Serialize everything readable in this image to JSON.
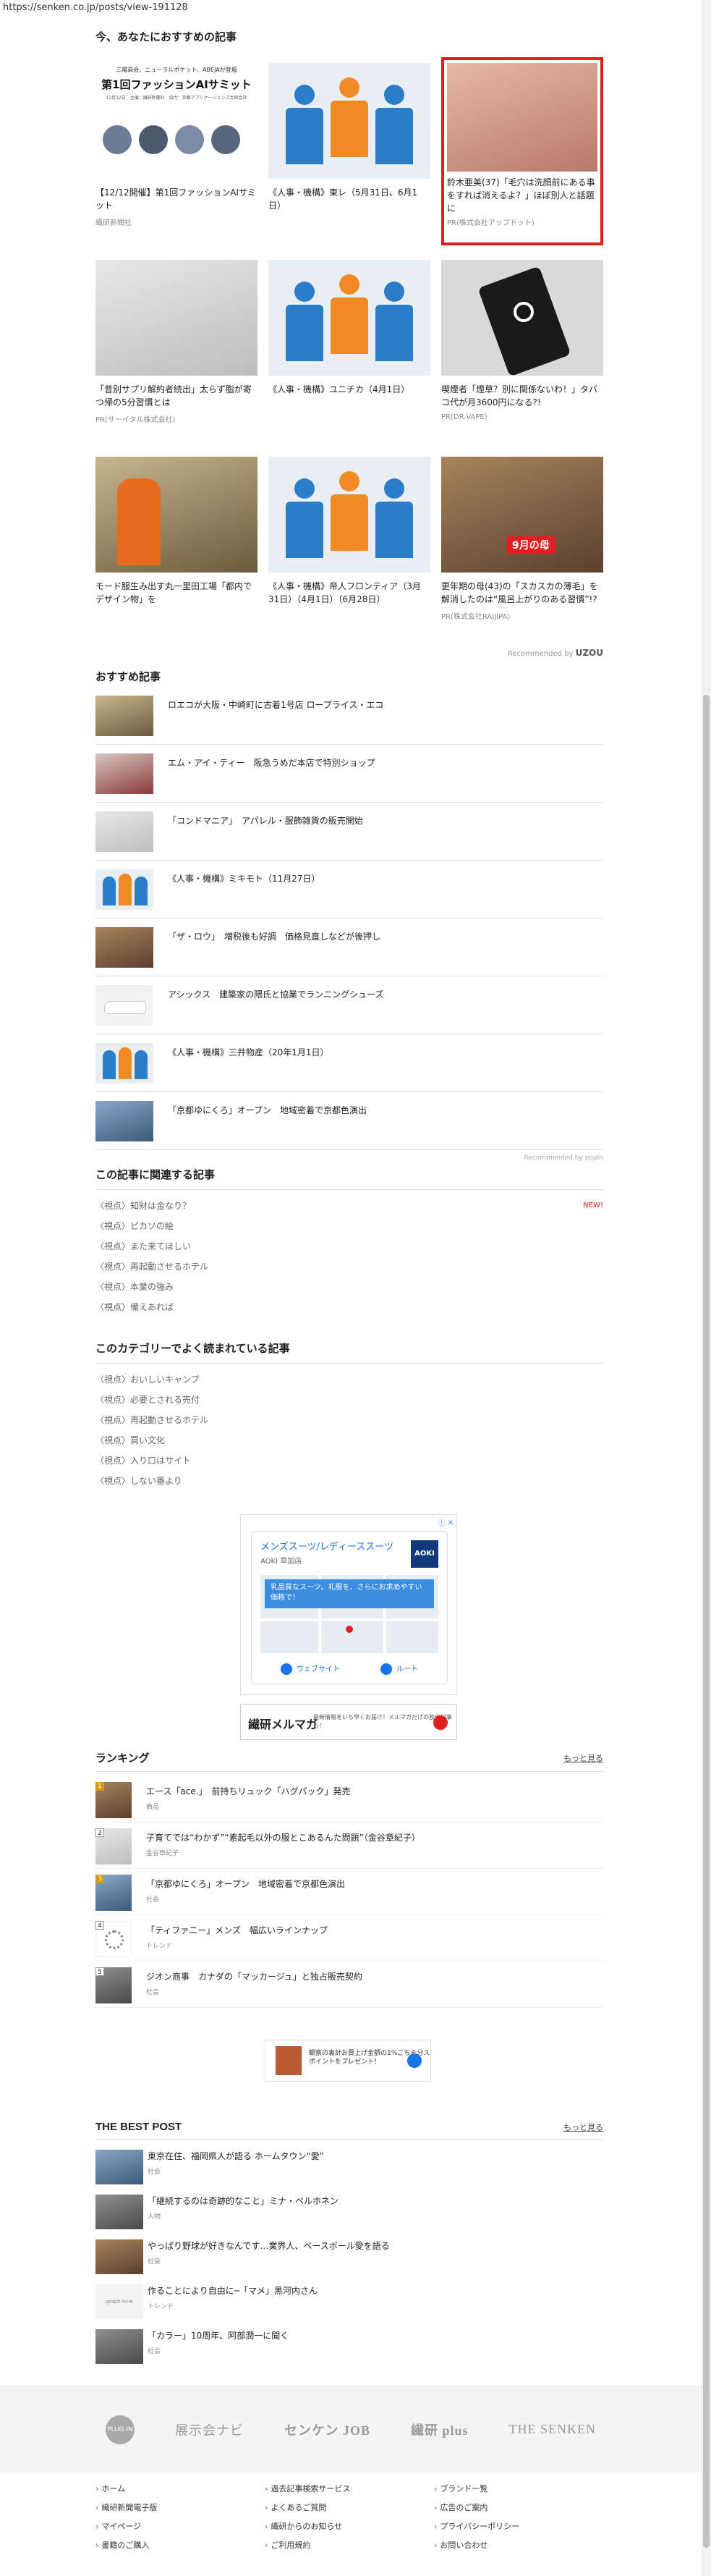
{
  "browser": {
    "url": "https://senken.co.jp/posts/view-191128"
  },
  "recommend": {
    "title": "今、あなたにおすすめの記事",
    "cards": [
      {
        "title": "【12/12開催】第1回ファッションAIサミット",
        "source": "繊研新聞社",
        "banner_line1": "三陽商会、ニューラルポケット、ABEJAが登壇",
        "banner_main": "第1回ファッションAIサミット",
        "banner_sub": "12月12日　主催：繊研新聞社　協力：京都アプリケーションズ合同会社"
      },
      {
        "title": "《人事・機構》東レ（5月31日、6月1日）",
        "source": ""
      },
      {
        "title": "鈴木亜美(37)「毛穴は洗顔前にある事をすれば消えるよ？」ほぼ別人と話題に",
        "source": "PR(株式会社アップドット)"
      },
      {
        "title": "「昔別サプリ解約者続出」太らず脂が寄つ帰の5分習慣とは",
        "source": "PR(サーイタル株式会社)"
      },
      {
        "title": "《人事・機構》ユニチカ（4月1日）",
        "source": ""
      },
      {
        "title": "喫煙者「煙草？別に関係ないわ！」タバコ代が月3600円になる?!",
        "source": "PR(DR.VAPE)"
      },
      {
        "title": "モード服生み出す丸一里田工場「都内でデザイン物」を",
        "source": ""
      },
      {
        "title": "《人事・機構》帝人フロンティア（3月31日）（4月1日）（6月28日）",
        "source": ""
      },
      {
        "title": "更年期の母(43)の「スカスカの薄毛」を解消したのは“風呂上がりのある習慣”!?",
        "source": "PR(株式会社RAIJIPA)",
        "overlay": "9月の母"
      }
    ],
    "credit_label": "Recommended by",
    "credit_brand": "UZOU"
  },
  "osusume": {
    "title": "おすすめ記事",
    "items": [
      "ロエコが大阪・中崎町に古着1号店 ロープライス・エコ",
      "エム・アイ・ティー　阪急うめだ本店で特別ショップ",
      "「コンドマニア」　アパレル・服飾雑貨の販売開始",
      "《人事・機構》ミキモト（11月27日）",
      "「ザ・ロウ」　増税後も好調　価格見直しなどが後押し",
      "アシックス　建築家の隈氏と協業でランニングシューズ",
      "《人事・機構》三井物産（20年1月1日）",
      "「京都ゆにくろ」オープン　地域密着で京都色演出"
    ],
    "credit": "Recommended by popIn"
  },
  "related": {
    "title": "この記事に関連する記事",
    "items": [
      {
        "text": "〈視点〉知財は金なり？",
        "new": "NEW!"
      },
      {
        "text": "〈視点〉ピカソの絵",
        "new": ""
      },
      {
        "text": "〈視点〉また来てほしい",
        "new": ""
      },
      {
        "text": "〈視点〉再起動させるホテル",
        "new": ""
      },
      {
        "text": "〈視点〉本業の強み",
        "new": ""
      },
      {
        "text": "〈視点〉備えあれば",
        "new": ""
      }
    ]
  },
  "category": {
    "title": "このカテゴリーでよく読まれている記事",
    "items": [
      "〈視点〉おいしいキャンプ",
      "〈視点〉必要とされる売付",
      "〈視点〉再起動させるホテル",
      "〈視点〉買い文化",
      "〈視点〉入り口はサイト",
      "〈視点〉しない番より"
    ]
  },
  "ad_map": {
    "title": "メンズスーツ/レディーススーツ",
    "sub": "AOKI 草加店",
    "logo": "AOKI",
    "banner": "乳品質なスーツ。礼服を、さらにお求めやすい価格で！",
    "btn_web": "ウェブサイト",
    "btn_route": "ルート"
  },
  "mail_banner": {
    "title": "繊研メルマガ",
    "sub": "最新情報をいち早くお届け！メルマガだけの独自記事も！"
  },
  "ranking": {
    "title": "ランキング",
    "more": "もっと見る",
    "items": [
      {
        "num": "1",
        "title": "エース「ace.」　前持ちリュック「ハグパック」発売",
        "sub": "商品"
      },
      {
        "num": "2",
        "title": "子育てでは“わかず”“素起毛以外の服とこあるんた問題”（金谷章紀子）",
        "sub": "金谷章紀子"
      },
      {
        "num": "3",
        "title": "「京都ゆにくろ」オープン　地域密着で京都色演出",
        "sub": "社会"
      },
      {
        "num": "4",
        "title": "「ティファニー」メンズ　幅広いラインナップ",
        "sub": "トレンド"
      },
      {
        "num": "5",
        "title": "ジオン商事　カナダの「マッカージュ」と独占販売契約",
        "sub": "社会"
      }
    ]
  },
  "ad_small": {
    "text": "観察の裏計お買上げ金額の1%ごちそ分スポイントをプレゼント！"
  },
  "best_post": {
    "title": "THE BEST POST",
    "more": "もっと見る",
    "items": [
      {
        "title": "東京在住、福岡県人が語る ホームタウン“愛”",
        "sub": "社会",
        "thumb_text": ""
      },
      {
        "title": "「継続するのは奇跡的なこと」ミナ・ペルホネン",
        "sub": "人物",
        "thumb_text": ""
      },
      {
        "title": "やっぱり野球が好きなんです…業界人、ベースボール愛を語る",
        "sub": "社会",
        "thumb_text": ""
      },
      {
        "title": "作ることにより自由に─「マメ」黒河内さん",
        "sub": "トレンド",
        "thumb_text": "graph-ticle"
      },
      {
        "title": "「カラー」10周年、阿部潤一に聞く",
        "sub": "社会",
        "thumb_text": ""
      }
    ]
  },
  "footer": {
    "brands": [
      "PLUG IN",
      "展示会ナビ",
      "センケン JOB",
      "繊研 plus",
      "THE SENKEN"
    ],
    "links": [
      "ホーム",
      "過去記事検索サービス",
      "ブランド一覧",
      "繊研新聞電子版",
      "よくあるご質問",
      "広告のご案内",
      "マイページ",
      "繊研からのお知らせ",
      "プライバシーポリシー",
      "書籍のご購入",
      "ご利用規約",
      "お問い合わせ"
    ]
  }
}
